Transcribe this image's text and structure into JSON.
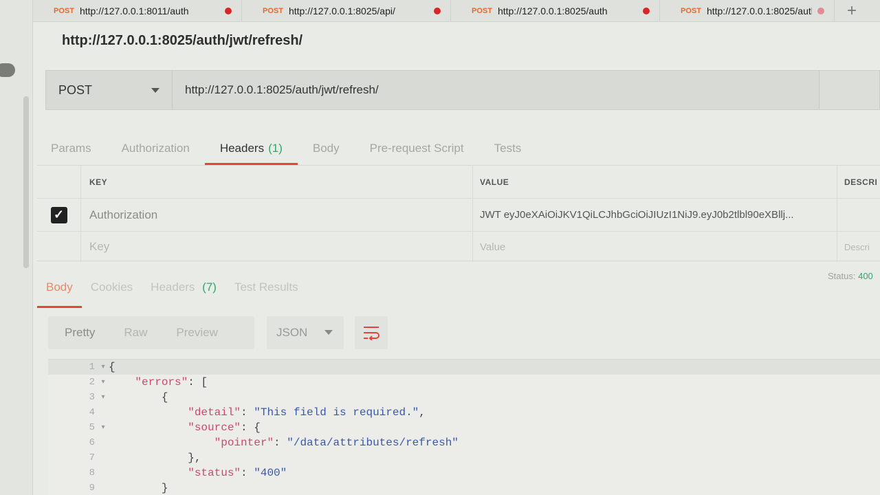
{
  "tabs": [
    {
      "method": "POST",
      "url": "http://127.0.0.1:8011/auth",
      "unsaved": true
    },
    {
      "method": "POST",
      "url": "http://127.0.0.1:8025/api/",
      "unsaved": true
    },
    {
      "method": "POST",
      "url": "http://127.0.0.1:8025/auth",
      "unsaved": true
    },
    {
      "method": "POST",
      "url": "http://127.0.0.1:8025/auth",
      "unsaved": true
    }
  ],
  "add_tab_label": "+",
  "title": "http://127.0.0.1:8025/auth/jwt/refresh/",
  "request": {
    "method": "POST",
    "url": "http://127.0.0.1:8025/auth/jwt/refresh/"
  },
  "request_tabs": {
    "params": "Params",
    "authorization": "Authorization",
    "headers": "Headers",
    "headers_count": "(1)",
    "body": "Body",
    "pre_request": "Pre-request Script",
    "tests": "Tests"
  },
  "headers_table": {
    "col_key": "KEY",
    "col_value": "VALUE",
    "col_desc": "DESCRI",
    "rows": [
      {
        "checked": true,
        "key": "Authorization",
        "value": "JWT eyJ0eXAiOiJKV1QiLCJhbGciOiJIUzI1NiJ9.eyJ0b2tlbl90eXBllj..."
      }
    ],
    "new_row": {
      "key_placeholder": "Key",
      "value_placeholder": "Value",
      "desc_placeholder": "Descri"
    }
  },
  "response_tabs": {
    "body": "Body",
    "cookies": "Cookies",
    "headers": "Headers",
    "headers_count": "(7)",
    "test_results": "Test Results"
  },
  "status": {
    "label": "Status:",
    "code": "400"
  },
  "format": {
    "pretty": "Pretty",
    "raw": "Raw",
    "preview": "Preview",
    "type": "JSON"
  },
  "code_lines": [
    {
      "n": "1",
      "fold": true
    },
    {
      "n": "2",
      "fold": true
    },
    {
      "n": "3",
      "fold": true
    },
    {
      "n": "4",
      "fold": false
    },
    {
      "n": "5",
      "fold": true
    },
    {
      "n": "6",
      "fold": false
    },
    {
      "n": "7",
      "fold": false
    },
    {
      "n": "8",
      "fold": false
    },
    {
      "n": "9",
      "fold": false
    }
  ],
  "json_text": {
    "open_brace": "{",
    "errors_key": "\"errors\"",
    "detail_key": "\"detail\"",
    "detail_val": "\"This field is required.\"",
    "source_key": "\"source\"",
    "pointer_key": "\"pointer\"",
    "pointer_val": "\"/data/attributes/refresh\"",
    "status_key": "\"status\"",
    "status_val": "\"400\""
  },
  "colors": {
    "method_post": "#e8682a",
    "unsaved_dot": "#d8262b",
    "active_tab_underline": "#e0453d",
    "count_green": "#2fa86a"
  }
}
